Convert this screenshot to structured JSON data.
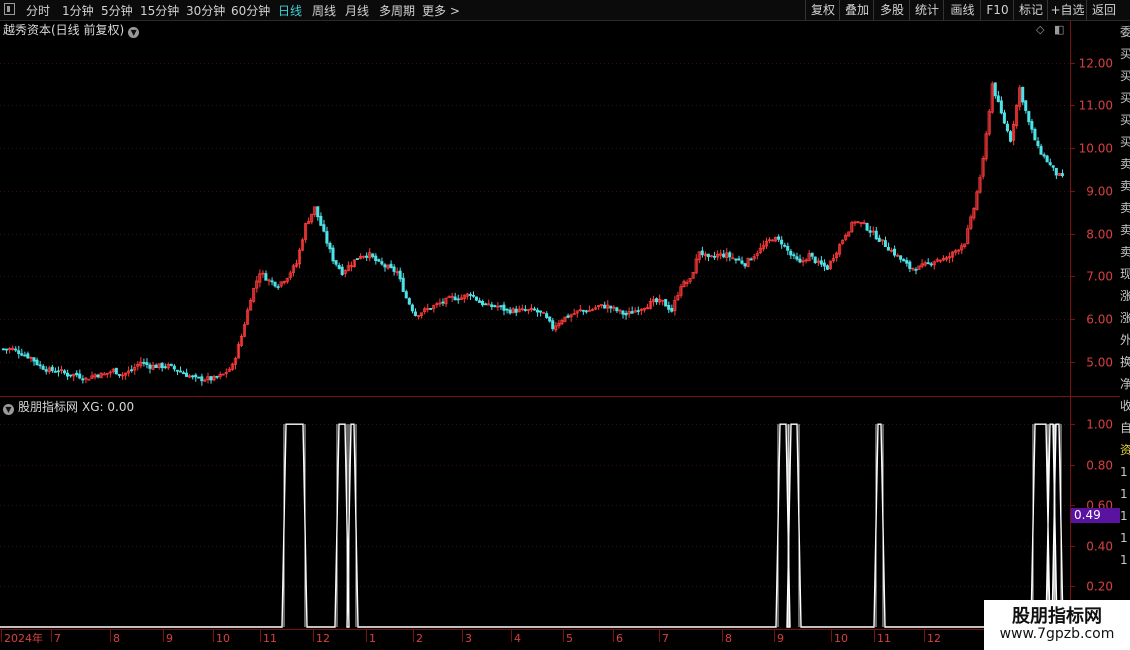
{
  "toolbar": {
    "periods": [
      "分时",
      "1分钟",
      "5分钟",
      "15分钟",
      "30分钟",
      "60分钟",
      "日线",
      "周线",
      "月线",
      "多周期",
      "更多 >"
    ],
    "active_period": "日线",
    "right_buttons": [
      "复权",
      "叠加",
      "多股",
      "统计",
      "画线",
      "F10",
      "标记",
      "+自选",
      "返回"
    ]
  },
  "main_panel": {
    "title": "越秀资本(日线 前复权)",
    "menu_icon": "chevron-down-icon",
    "top_icons": [
      "diamond-icon",
      "panel-icon"
    ]
  },
  "indicator_panel": {
    "name": "股朋指标网",
    "value_text": "XG: 0.00",
    "current_value_tag": "0.49",
    "menu_icon": "chevron-down-icon"
  },
  "right_strip_chars": [
    "委",
    "买",
    "买",
    "买",
    "买",
    "买",
    "卖",
    "卖",
    "卖",
    "卖",
    "卖",
    "现",
    "涨",
    "涨",
    "外",
    "换",
    "净",
    "收",
    "自",
    "资",
    "1",
    "1",
    "1",
    "1",
    "1"
  ],
  "watermark": {
    "line1": "股朋指标网",
    "line2": "www.7gpzb.com"
  },
  "colors": {
    "up": "#ff3b3b",
    "down": "#4fe3e8",
    "axis": "#7a1212",
    "grid": "#3a0d0d",
    "tick_text": "#d84040",
    "signal": "#ffffff",
    "tag_bg": "#5a13a0"
  },
  "chart_data": [
    {
      "type": "candlestick",
      "ylim": [
        4.2,
        12.6
      ],
      "y_ticks": [
        "5.00",
        "6.00",
        "7.00",
        "8.00",
        "9.00",
        "10.00",
        "11.00",
        "12.00"
      ],
      "x_ticks": [
        "2024年",
        "7",
        "8",
        "9",
        "10",
        "11",
        "12",
        "1",
        "2",
        "3",
        "4",
        "5",
        "6",
        "7",
        "8",
        "9",
        "10",
        "11",
        "12"
      ],
      "closes": [
        5.3,
        5.3,
        5.2,
        5.1,
        4.9,
        4.8,
        4.8,
        4.7,
        4.7,
        4.6,
        4.7,
        4.7,
        4.8,
        4.7,
        4.8,
        5.0,
        4.9,
        4.9,
        4.9,
        4.8,
        4.7,
        4.6,
        4.6,
        4.6,
        4.7,
        4.9,
        5.6,
        6.5,
        7.1,
        6.9,
        6.8,
        7.0,
        7.3,
        8.2,
        8.6,
        8.0,
        7.4,
        7.1,
        7.3,
        7.5,
        7.5,
        7.3,
        7.2,
        7.1,
        6.5,
        6.1,
        6.2,
        6.3,
        6.4,
        6.5,
        6.5,
        6.6,
        6.4,
        6.3,
        6.3,
        6.2,
        6.2,
        6.2,
        6.2,
        6.1,
        5.8,
        6.0,
        6.1,
        6.2,
        6.2,
        6.3,
        6.3,
        6.2,
        6.1,
        6.2,
        6.3,
        6.4,
        6.4,
        6.2,
        6.8,
        6.9,
        7.6,
        7.4,
        7.5,
        7.5,
        7.4,
        7.3,
        7.5,
        7.7,
        7.9,
        7.8,
        7.5,
        7.3,
        7.5,
        7.3,
        7.2,
        7.6,
        8.0,
        8.3,
        8.2,
        8.0,
        7.8,
        7.6,
        7.4,
        7.2,
        7.2,
        7.3,
        7.4,
        7.4,
        7.6,
        7.8,
        8.6,
        9.7,
        11.5,
        10.8,
        10.2,
        11.4,
        10.6,
        10.0,
        9.7,
        9.4
      ]
    },
    {
      "type": "line",
      "ylim": [
        0,
        1.05
      ],
      "y_ticks": [
        "0.20",
        "0.40",
        "0.60",
        "0.80",
        "1.00"
      ],
      "name": "XG",
      "signal_ranges": [
        [
          286,
          303
        ],
        [
          339,
          345
        ],
        [
          351,
          354
        ],
        [
          780,
          786
        ],
        [
          791,
          797
        ],
        [
          878,
          881
        ],
        [
          1035,
          1046
        ],
        [
          1050,
          1053
        ],
        [
          1056,
          1059
        ]
      ]
    }
  ]
}
